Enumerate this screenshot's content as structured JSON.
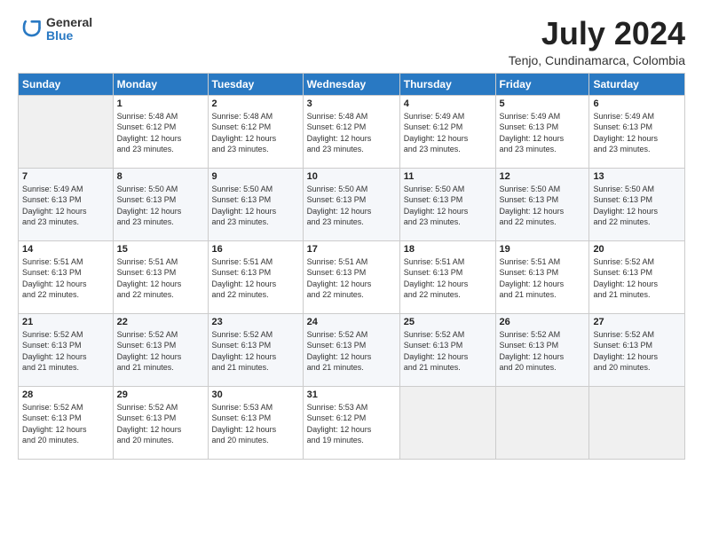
{
  "header": {
    "logo_general": "General",
    "logo_blue": "Blue",
    "month": "July 2024",
    "location": "Tenjo, Cundinamarca, Colombia"
  },
  "weekdays": [
    "Sunday",
    "Monday",
    "Tuesday",
    "Wednesday",
    "Thursday",
    "Friday",
    "Saturday"
  ],
  "weeks": [
    [
      {
        "day": "",
        "info": ""
      },
      {
        "day": "1",
        "info": "Sunrise: 5:48 AM\nSunset: 6:12 PM\nDaylight: 12 hours\nand 23 minutes."
      },
      {
        "day": "2",
        "info": "Sunrise: 5:48 AM\nSunset: 6:12 PM\nDaylight: 12 hours\nand 23 minutes."
      },
      {
        "day": "3",
        "info": "Sunrise: 5:48 AM\nSunset: 6:12 PM\nDaylight: 12 hours\nand 23 minutes."
      },
      {
        "day": "4",
        "info": "Sunrise: 5:49 AM\nSunset: 6:12 PM\nDaylight: 12 hours\nand 23 minutes."
      },
      {
        "day": "5",
        "info": "Sunrise: 5:49 AM\nSunset: 6:13 PM\nDaylight: 12 hours\nand 23 minutes."
      },
      {
        "day": "6",
        "info": "Sunrise: 5:49 AM\nSunset: 6:13 PM\nDaylight: 12 hours\nand 23 minutes."
      }
    ],
    [
      {
        "day": "7",
        "info": "Sunrise: 5:49 AM\nSunset: 6:13 PM\nDaylight: 12 hours\nand 23 minutes."
      },
      {
        "day": "8",
        "info": "Sunrise: 5:50 AM\nSunset: 6:13 PM\nDaylight: 12 hours\nand 23 minutes."
      },
      {
        "day": "9",
        "info": "Sunrise: 5:50 AM\nSunset: 6:13 PM\nDaylight: 12 hours\nand 23 minutes."
      },
      {
        "day": "10",
        "info": "Sunrise: 5:50 AM\nSunset: 6:13 PM\nDaylight: 12 hours\nand 23 minutes."
      },
      {
        "day": "11",
        "info": "Sunrise: 5:50 AM\nSunset: 6:13 PM\nDaylight: 12 hours\nand 23 minutes."
      },
      {
        "day": "12",
        "info": "Sunrise: 5:50 AM\nSunset: 6:13 PM\nDaylight: 12 hours\nand 22 minutes."
      },
      {
        "day": "13",
        "info": "Sunrise: 5:50 AM\nSunset: 6:13 PM\nDaylight: 12 hours\nand 22 minutes."
      }
    ],
    [
      {
        "day": "14",
        "info": "Sunrise: 5:51 AM\nSunset: 6:13 PM\nDaylight: 12 hours\nand 22 minutes."
      },
      {
        "day": "15",
        "info": "Sunrise: 5:51 AM\nSunset: 6:13 PM\nDaylight: 12 hours\nand 22 minutes."
      },
      {
        "day": "16",
        "info": "Sunrise: 5:51 AM\nSunset: 6:13 PM\nDaylight: 12 hours\nand 22 minutes."
      },
      {
        "day": "17",
        "info": "Sunrise: 5:51 AM\nSunset: 6:13 PM\nDaylight: 12 hours\nand 22 minutes."
      },
      {
        "day": "18",
        "info": "Sunrise: 5:51 AM\nSunset: 6:13 PM\nDaylight: 12 hours\nand 22 minutes."
      },
      {
        "day": "19",
        "info": "Sunrise: 5:51 AM\nSunset: 6:13 PM\nDaylight: 12 hours\nand 21 minutes."
      },
      {
        "day": "20",
        "info": "Sunrise: 5:52 AM\nSunset: 6:13 PM\nDaylight: 12 hours\nand 21 minutes."
      }
    ],
    [
      {
        "day": "21",
        "info": "Sunrise: 5:52 AM\nSunset: 6:13 PM\nDaylight: 12 hours\nand 21 minutes."
      },
      {
        "day": "22",
        "info": "Sunrise: 5:52 AM\nSunset: 6:13 PM\nDaylight: 12 hours\nand 21 minutes."
      },
      {
        "day": "23",
        "info": "Sunrise: 5:52 AM\nSunset: 6:13 PM\nDaylight: 12 hours\nand 21 minutes."
      },
      {
        "day": "24",
        "info": "Sunrise: 5:52 AM\nSunset: 6:13 PM\nDaylight: 12 hours\nand 21 minutes."
      },
      {
        "day": "25",
        "info": "Sunrise: 5:52 AM\nSunset: 6:13 PM\nDaylight: 12 hours\nand 21 minutes."
      },
      {
        "day": "26",
        "info": "Sunrise: 5:52 AM\nSunset: 6:13 PM\nDaylight: 12 hours\nand 20 minutes."
      },
      {
        "day": "27",
        "info": "Sunrise: 5:52 AM\nSunset: 6:13 PM\nDaylight: 12 hours\nand 20 minutes."
      }
    ],
    [
      {
        "day": "28",
        "info": "Sunrise: 5:52 AM\nSunset: 6:13 PM\nDaylight: 12 hours\nand 20 minutes."
      },
      {
        "day": "29",
        "info": "Sunrise: 5:52 AM\nSunset: 6:13 PM\nDaylight: 12 hours\nand 20 minutes."
      },
      {
        "day": "30",
        "info": "Sunrise: 5:53 AM\nSunset: 6:13 PM\nDaylight: 12 hours\nand 20 minutes."
      },
      {
        "day": "31",
        "info": "Sunrise: 5:53 AM\nSunset: 6:12 PM\nDaylight: 12 hours\nand 19 minutes."
      },
      {
        "day": "",
        "info": ""
      },
      {
        "day": "",
        "info": ""
      },
      {
        "day": "",
        "info": ""
      }
    ]
  ]
}
